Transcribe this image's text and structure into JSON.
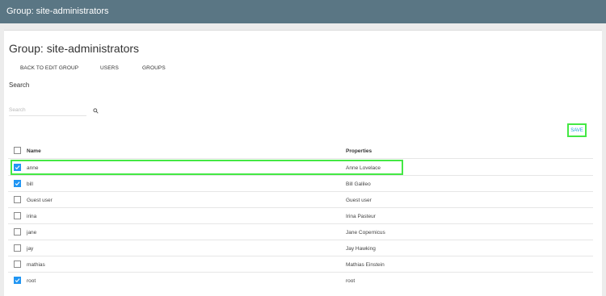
{
  "topbar": {
    "title": "Group: site-administrators"
  },
  "page": {
    "title": "Group: site-administrators"
  },
  "nav": {
    "back_label": "BACK TO EDIT GROUP",
    "users_label": "USERS",
    "groups_label": "GROUPS"
  },
  "search": {
    "heading": "Search",
    "placeholder": "Search",
    "icon": "search-icon"
  },
  "toolbar": {
    "save_label": "SAVE"
  },
  "table": {
    "headers": {
      "name": "Name",
      "properties": "Properties"
    },
    "select_all_checked": false,
    "rows": [
      {
        "name": "anne",
        "properties": "Anne Lovelace",
        "checked": true
      },
      {
        "name": "bill",
        "properties": "Bill Galileo",
        "checked": true
      },
      {
        "name": "Guest user",
        "properties": "Guest user",
        "checked": false
      },
      {
        "name": "irina",
        "properties": "Irina Pasteur",
        "checked": false
      },
      {
        "name": "jane",
        "properties": "Jane Copernicus",
        "checked": false
      },
      {
        "name": "jay",
        "properties": "Jay Hawking",
        "checked": false
      },
      {
        "name": "mathias",
        "properties": "Mathias Einstein",
        "checked": false
      },
      {
        "name": "root",
        "properties": "root",
        "checked": true
      }
    ]
  },
  "colors": {
    "topbar": "#5a7684",
    "accent": "#2196f3",
    "link": "#1da2d8",
    "highlight": "#44e844"
  }
}
